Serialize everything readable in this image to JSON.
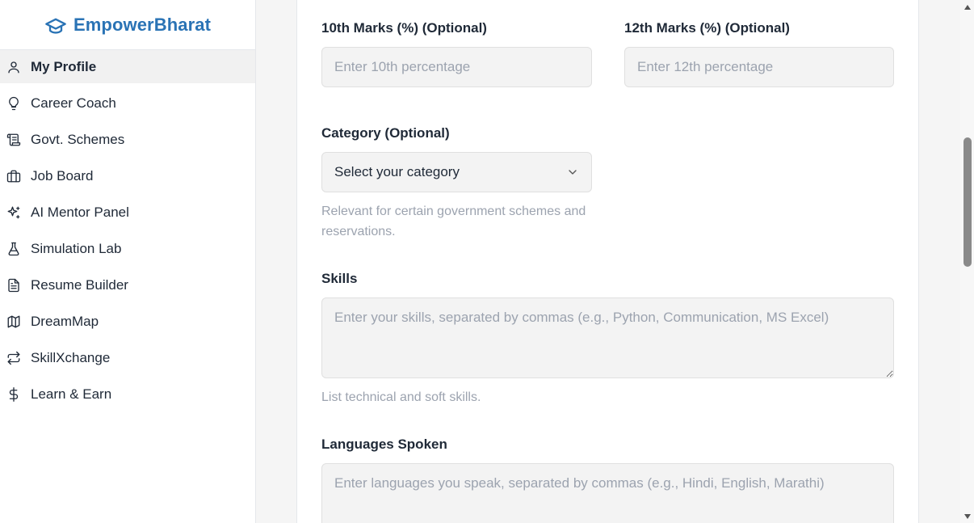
{
  "brand": {
    "name": "EmpowerBharat",
    "icon": "graduation-cap-icon",
    "color": "#2a73b5"
  },
  "sidebar": {
    "items": [
      {
        "label": "My Profile",
        "icon": "user-icon",
        "active": true
      },
      {
        "label": "Career Coach",
        "icon": "lightbulb-icon"
      },
      {
        "label": "Govt. Schemes",
        "icon": "scroll-icon"
      },
      {
        "label": "Job Board",
        "icon": "briefcase-icon"
      },
      {
        "label": "AI Mentor Panel",
        "icon": "sparkles-icon"
      },
      {
        "label": "Simulation Lab",
        "icon": "flask-icon"
      },
      {
        "label": "Resume Builder",
        "icon": "file-text-icon"
      },
      {
        "label": "DreamMap",
        "icon": "map-icon"
      },
      {
        "label": "SkillXchange",
        "icon": "repeat-icon"
      },
      {
        "label": "Learn & Earn",
        "icon": "dollar-icon"
      }
    ]
  },
  "form": {
    "marks10": {
      "label": "10th Marks (%) (Optional)",
      "placeholder": "Enter 10th percentage",
      "value": ""
    },
    "marks12": {
      "label": "12th Marks (%) (Optional)",
      "placeholder": "Enter 12th percentage",
      "value": ""
    },
    "category": {
      "label": "Category (Optional)",
      "selected": "Select your category",
      "help": "Relevant for certain government schemes and reservations."
    },
    "skills": {
      "label": "Skills",
      "placeholder": "Enter your skills, separated by commas (e.g., Python, Communication, MS Excel)",
      "value": "",
      "help": "List technical and soft skills."
    },
    "languages": {
      "label": "Languages Spoken",
      "placeholder": "Enter languages you speak, separated by commas (e.g., Hindi, English, Marathi)",
      "value": ""
    }
  }
}
